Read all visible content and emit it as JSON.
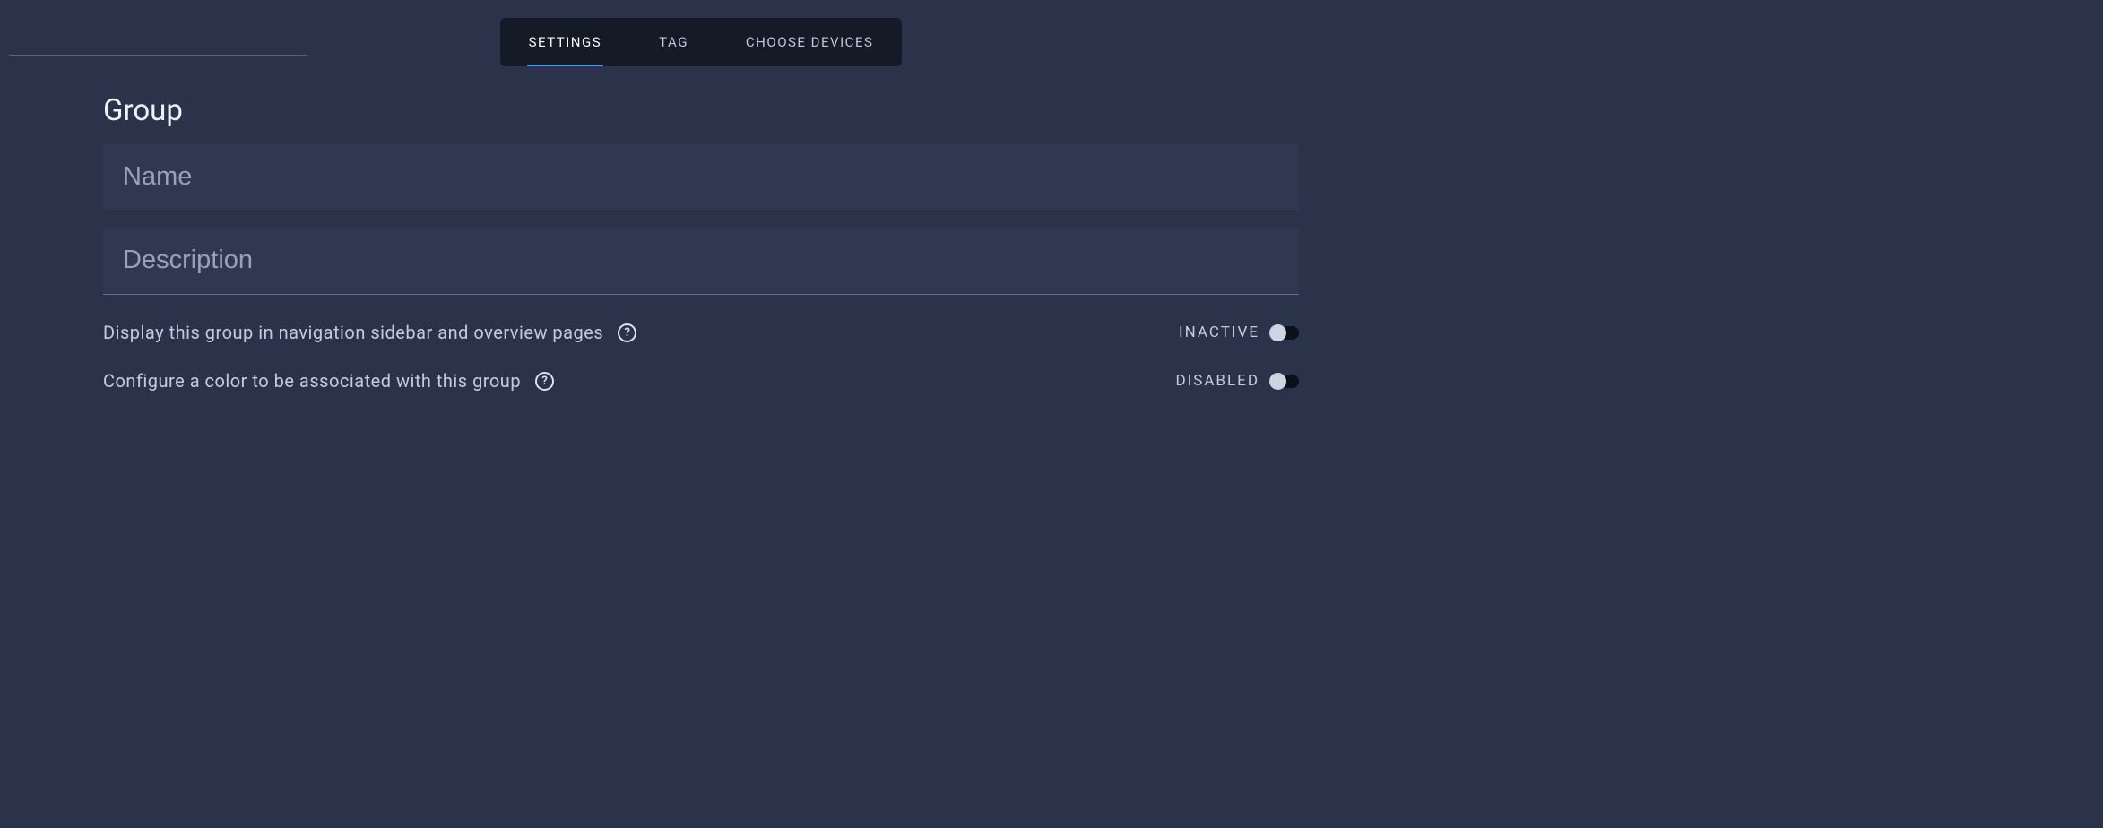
{
  "tabs": {
    "settings": "SETTINGS",
    "tag": "TAG",
    "choose_devices": "CHOOSE DEVICES",
    "active": "settings"
  },
  "section": {
    "title": "Group"
  },
  "fields": {
    "name_placeholder": "Name",
    "name_value": "",
    "description_placeholder": "Description",
    "description_value": ""
  },
  "options": {
    "display_in_sidebar": {
      "label": "Display this group in navigation sidebar and overview pages",
      "state_label": "INACTIVE",
      "value": false
    },
    "configure_color": {
      "label": "Configure a color to be associated with this group",
      "state_label": "DISABLED",
      "value": false
    }
  },
  "icons": {
    "help": "?"
  }
}
